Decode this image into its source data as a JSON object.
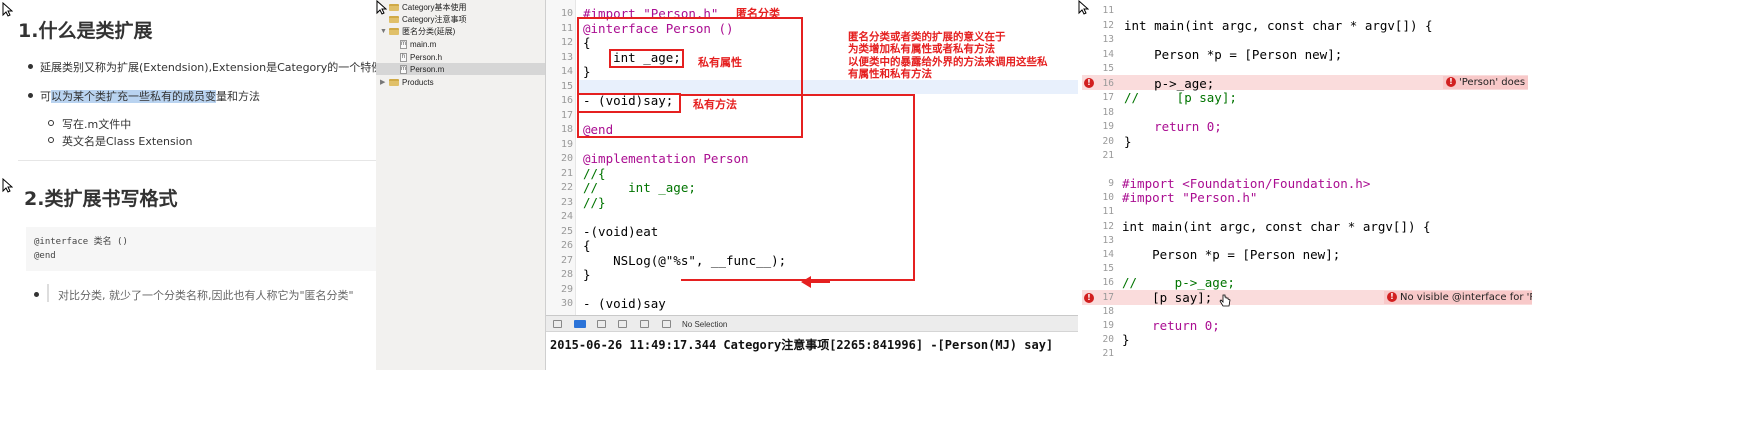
{
  "notes": {
    "heading1": "1.什么是类扩展",
    "bullet1": "延展类别又称为扩展(Extendsion),Extension是Category的一个特例",
    "bullet2_pre": "可",
    "bullet2_hl": "以为某个类扩充一些私有的成员变",
    "bullet2_post": "量和方法",
    "sub1": "写在.m文件中",
    "sub2": "英文名是Class Extension",
    "heading2": "2.类扩展书写格式",
    "code_line1": "@interface 类名 ()",
    "code_line2": "@end",
    "quote": "对比分类, 就少了一个分类名称,因此也有人称它为\"匿名分类\""
  },
  "navigator": {
    "items": [
      {
        "label": "Category基本使用",
        "type": "folder"
      },
      {
        "label": "Category注意事项",
        "type": "folder"
      },
      {
        "label": "匿名分类(延展)",
        "type": "folder-open"
      },
      {
        "label": "main.m",
        "type": "file-m"
      },
      {
        "label": "Person.h",
        "type": "file-h"
      },
      {
        "label": "Person.m",
        "type": "file-m"
      },
      {
        "label": "Products",
        "type": "folder"
      }
    ]
  },
  "editor": {
    "lines": [
      {
        "n": "10",
        "text": "#import \"Person.h\""
      },
      {
        "n": "11",
        "text": "@interface Person ()"
      },
      {
        "n": "12",
        "text": "{"
      },
      {
        "n": "13",
        "text": "    int _age;"
      },
      {
        "n": "14",
        "text": "}"
      },
      {
        "n": "15",
        "text": ""
      },
      {
        "n": "16",
        "text": "- (void)say;"
      },
      {
        "n": "17",
        "text": ""
      },
      {
        "n": "18",
        "text": "@end"
      },
      {
        "n": "19",
        "text": ""
      },
      {
        "n": "20",
        "text": "@implementation Person"
      },
      {
        "n": "21",
        "text": "//{"
      },
      {
        "n": "22",
        "text": "//    int _age;"
      },
      {
        "n": "23",
        "text": "//}"
      },
      {
        "n": "24",
        "text": ""
      },
      {
        "n": "25",
        "text": "-(void)eat"
      },
      {
        "n": "26",
        "text": "{"
      },
      {
        "n": "27",
        "text": "    NSLog(@\"%s\", __func__);"
      },
      {
        "n": "28",
        "text": "}"
      },
      {
        "n": "29",
        "text": ""
      },
      {
        "n": "30",
        "text": "- (void)say"
      }
    ],
    "annotations": {
      "title": "匿名分类",
      "private_property": "私有属性",
      "private_method": "私有方法",
      "explain_1": "匿名分类或者类的扩展的意义在于",
      "explain_2": "为类增加私有属性或者私有方法",
      "explain_3": "以便类中的暴露给外界的方法来调用这些私",
      "explain_4": "有属性和私有方法"
    }
  },
  "debug": {
    "status": "No Selection",
    "console": "2015-06-26 11:49:17.344 Category注意事项[2265:841996] -[Person(MJ) say]"
  },
  "right_top": {
    "lines": [
      {
        "n": "11",
        "text": ""
      },
      {
        "n": "12",
        "text": "int main(int argc, const char * argv[]) {"
      },
      {
        "n": "13",
        "text": ""
      },
      {
        "n": "14",
        "text": "    Person *p = [Person new];"
      },
      {
        "n": "15",
        "text": ""
      },
      {
        "n": "16",
        "text": "    p->_age;"
      },
      {
        "n": "17",
        "text": "//     [p say];"
      },
      {
        "n": "18",
        "text": ""
      },
      {
        "n": "19",
        "text": "    return 0;"
      },
      {
        "n": "20",
        "text": "}"
      },
      {
        "n": "21",
        "text": ""
      }
    ],
    "error": "'Person' does"
  },
  "right_bottom": {
    "lines": [
      {
        "n": "9",
        "text": "#import <Foundation/Foundation.h>"
      },
      {
        "n": "10",
        "text": "#import \"Person.h\""
      },
      {
        "n": "11",
        "text": ""
      },
      {
        "n": "12",
        "text": "int main(int argc, const char * argv[]) {"
      },
      {
        "n": "13",
        "text": ""
      },
      {
        "n": "14",
        "text": "    Person *p = [Person new];"
      },
      {
        "n": "15",
        "text": ""
      },
      {
        "n": "16",
        "text": "//     p->_age;"
      },
      {
        "n": "17",
        "text": "    [p say];"
      },
      {
        "n": "18",
        "text": ""
      },
      {
        "n": "19",
        "text": "    return 0;"
      },
      {
        "n": "20",
        "text": "}"
      },
      {
        "n": "21",
        "text": ""
      }
    ],
    "error": "No visible @interface for 'P"
  },
  "colors": {
    "annotation_red": "#e52020",
    "keyword": "#aa0d91",
    "comment": "#007400",
    "error_bg": "#fadcdc"
  }
}
